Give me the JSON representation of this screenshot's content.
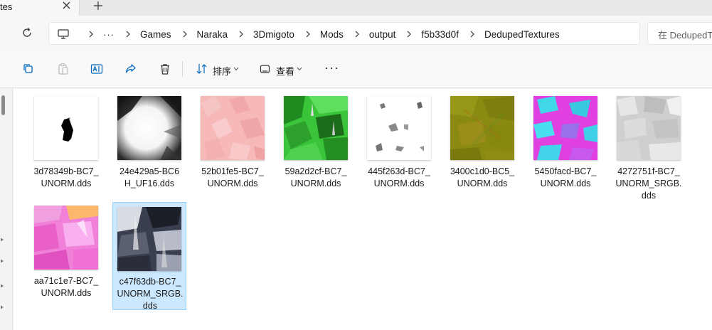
{
  "tab": {
    "title": "tes"
  },
  "breadcrumb": {
    "overflow": "···",
    "items": [
      "Games",
      "Naraka",
      "3Dmigoto",
      "Mods",
      "output",
      "f5b33d0f",
      "DedupedTextures"
    ]
  },
  "search": {
    "placeholder": "在 DedupedTextures"
  },
  "toolbar": {
    "sort_label": "排序",
    "view_label": "查看",
    "more_label": "···"
  },
  "files": [
    {
      "name_line1": "3d78349b-BC7_",
      "name_line2": "UNORM.dds",
      "name_line3": ""
    },
    {
      "name_line1": "24e429a5-BC6",
      "name_line2": "H_UF16.dds",
      "name_line3": ""
    },
    {
      "name_line1": "52b01fe5-BC7_",
      "name_line2": "UNORM.dds",
      "name_line3": ""
    },
    {
      "name_line1": "59a2d2cf-BC7_",
      "name_line2": "UNORM.dds",
      "name_line3": ""
    },
    {
      "name_line1": "445f263d-BC7_",
      "name_line2": "UNORM.dds",
      "name_line3": ""
    },
    {
      "name_line1": "3400c1d0-BC5_",
      "name_line2": "UNORM.dds",
      "name_line3": ""
    },
    {
      "name_line1": "5450facd-BC7_",
      "name_line2": "UNORM.dds",
      "name_line3": ""
    },
    {
      "name_line1": "4272751f-BC7_",
      "name_line2": "UNORM_SRGB.",
      "name_line3": "dds"
    },
    {
      "name_line1": "aa71c1e7-BC7_",
      "name_line2": "UNORM.dds",
      "name_line3": ""
    },
    {
      "name_line1": "c47f63db-BC7_",
      "name_line2": "UNORM_SRGB.",
      "name_line3": "dds"
    }
  ],
  "colors": {
    "selection": "#cce8ff",
    "selection_border": "#99d1ff",
    "accent": "#0067c0"
  }
}
